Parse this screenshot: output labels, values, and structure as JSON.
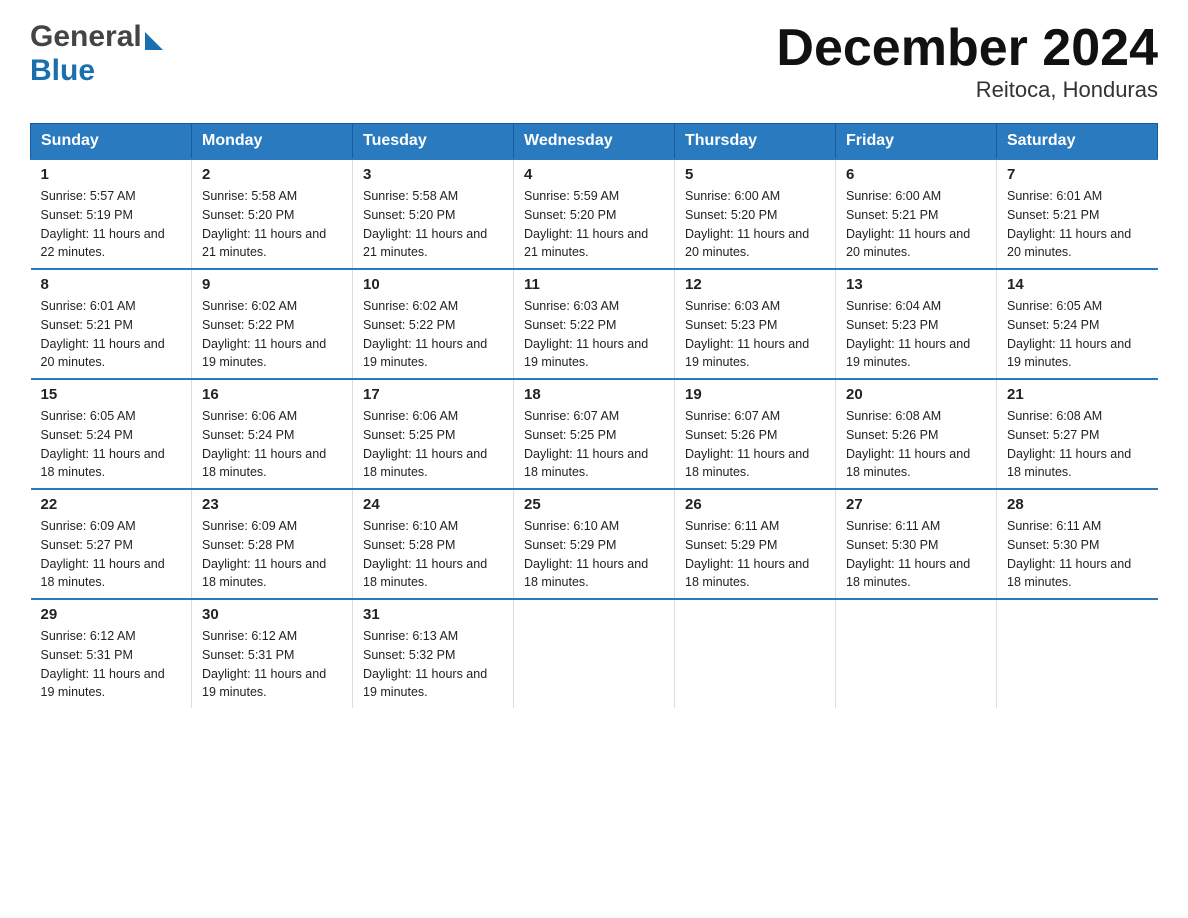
{
  "logo": {
    "general": "General",
    "blue": "Blue",
    "triangle_alt": "arrow"
  },
  "title": "December 2024",
  "subtitle": "Reitoca, Honduras",
  "days_of_week": [
    "Sunday",
    "Monday",
    "Tuesday",
    "Wednesday",
    "Thursday",
    "Friday",
    "Saturday"
  ],
  "weeks": [
    [
      {
        "day": "1",
        "sunrise": "Sunrise: 5:57 AM",
        "sunset": "Sunset: 5:19 PM",
        "daylight": "Daylight: 11 hours and 22 minutes."
      },
      {
        "day": "2",
        "sunrise": "Sunrise: 5:58 AM",
        "sunset": "Sunset: 5:20 PM",
        "daylight": "Daylight: 11 hours and 21 minutes."
      },
      {
        "day": "3",
        "sunrise": "Sunrise: 5:58 AM",
        "sunset": "Sunset: 5:20 PM",
        "daylight": "Daylight: 11 hours and 21 minutes."
      },
      {
        "day": "4",
        "sunrise": "Sunrise: 5:59 AM",
        "sunset": "Sunset: 5:20 PM",
        "daylight": "Daylight: 11 hours and 21 minutes."
      },
      {
        "day": "5",
        "sunrise": "Sunrise: 6:00 AM",
        "sunset": "Sunset: 5:20 PM",
        "daylight": "Daylight: 11 hours and 20 minutes."
      },
      {
        "day": "6",
        "sunrise": "Sunrise: 6:00 AM",
        "sunset": "Sunset: 5:21 PM",
        "daylight": "Daylight: 11 hours and 20 minutes."
      },
      {
        "day": "7",
        "sunrise": "Sunrise: 6:01 AM",
        "sunset": "Sunset: 5:21 PM",
        "daylight": "Daylight: 11 hours and 20 minutes."
      }
    ],
    [
      {
        "day": "8",
        "sunrise": "Sunrise: 6:01 AM",
        "sunset": "Sunset: 5:21 PM",
        "daylight": "Daylight: 11 hours and 20 minutes."
      },
      {
        "day": "9",
        "sunrise": "Sunrise: 6:02 AM",
        "sunset": "Sunset: 5:22 PM",
        "daylight": "Daylight: 11 hours and 19 minutes."
      },
      {
        "day": "10",
        "sunrise": "Sunrise: 6:02 AM",
        "sunset": "Sunset: 5:22 PM",
        "daylight": "Daylight: 11 hours and 19 minutes."
      },
      {
        "day": "11",
        "sunrise": "Sunrise: 6:03 AM",
        "sunset": "Sunset: 5:22 PM",
        "daylight": "Daylight: 11 hours and 19 minutes."
      },
      {
        "day": "12",
        "sunrise": "Sunrise: 6:03 AM",
        "sunset": "Sunset: 5:23 PM",
        "daylight": "Daylight: 11 hours and 19 minutes."
      },
      {
        "day": "13",
        "sunrise": "Sunrise: 6:04 AM",
        "sunset": "Sunset: 5:23 PM",
        "daylight": "Daylight: 11 hours and 19 minutes."
      },
      {
        "day": "14",
        "sunrise": "Sunrise: 6:05 AM",
        "sunset": "Sunset: 5:24 PM",
        "daylight": "Daylight: 11 hours and 19 minutes."
      }
    ],
    [
      {
        "day": "15",
        "sunrise": "Sunrise: 6:05 AM",
        "sunset": "Sunset: 5:24 PM",
        "daylight": "Daylight: 11 hours and 18 minutes."
      },
      {
        "day": "16",
        "sunrise": "Sunrise: 6:06 AM",
        "sunset": "Sunset: 5:24 PM",
        "daylight": "Daylight: 11 hours and 18 minutes."
      },
      {
        "day": "17",
        "sunrise": "Sunrise: 6:06 AM",
        "sunset": "Sunset: 5:25 PM",
        "daylight": "Daylight: 11 hours and 18 minutes."
      },
      {
        "day": "18",
        "sunrise": "Sunrise: 6:07 AM",
        "sunset": "Sunset: 5:25 PM",
        "daylight": "Daylight: 11 hours and 18 minutes."
      },
      {
        "day": "19",
        "sunrise": "Sunrise: 6:07 AM",
        "sunset": "Sunset: 5:26 PM",
        "daylight": "Daylight: 11 hours and 18 minutes."
      },
      {
        "day": "20",
        "sunrise": "Sunrise: 6:08 AM",
        "sunset": "Sunset: 5:26 PM",
        "daylight": "Daylight: 11 hours and 18 minutes."
      },
      {
        "day": "21",
        "sunrise": "Sunrise: 6:08 AM",
        "sunset": "Sunset: 5:27 PM",
        "daylight": "Daylight: 11 hours and 18 minutes."
      }
    ],
    [
      {
        "day": "22",
        "sunrise": "Sunrise: 6:09 AM",
        "sunset": "Sunset: 5:27 PM",
        "daylight": "Daylight: 11 hours and 18 minutes."
      },
      {
        "day": "23",
        "sunrise": "Sunrise: 6:09 AM",
        "sunset": "Sunset: 5:28 PM",
        "daylight": "Daylight: 11 hours and 18 minutes."
      },
      {
        "day": "24",
        "sunrise": "Sunrise: 6:10 AM",
        "sunset": "Sunset: 5:28 PM",
        "daylight": "Daylight: 11 hours and 18 minutes."
      },
      {
        "day": "25",
        "sunrise": "Sunrise: 6:10 AM",
        "sunset": "Sunset: 5:29 PM",
        "daylight": "Daylight: 11 hours and 18 minutes."
      },
      {
        "day": "26",
        "sunrise": "Sunrise: 6:11 AM",
        "sunset": "Sunset: 5:29 PM",
        "daylight": "Daylight: 11 hours and 18 minutes."
      },
      {
        "day": "27",
        "sunrise": "Sunrise: 6:11 AM",
        "sunset": "Sunset: 5:30 PM",
        "daylight": "Daylight: 11 hours and 18 minutes."
      },
      {
        "day": "28",
        "sunrise": "Sunrise: 6:11 AM",
        "sunset": "Sunset: 5:30 PM",
        "daylight": "Daylight: 11 hours and 18 minutes."
      }
    ],
    [
      {
        "day": "29",
        "sunrise": "Sunrise: 6:12 AM",
        "sunset": "Sunset: 5:31 PM",
        "daylight": "Daylight: 11 hours and 19 minutes."
      },
      {
        "day": "30",
        "sunrise": "Sunrise: 6:12 AM",
        "sunset": "Sunset: 5:31 PM",
        "daylight": "Daylight: 11 hours and 19 minutes."
      },
      {
        "day": "31",
        "sunrise": "Sunrise: 6:13 AM",
        "sunset": "Sunset: 5:32 PM",
        "daylight": "Daylight: 11 hours and 19 minutes."
      },
      {
        "day": "",
        "sunrise": "",
        "sunset": "",
        "daylight": ""
      },
      {
        "day": "",
        "sunrise": "",
        "sunset": "",
        "daylight": ""
      },
      {
        "day": "",
        "sunrise": "",
        "sunset": "",
        "daylight": ""
      },
      {
        "day": "",
        "sunrise": "",
        "sunset": "",
        "daylight": ""
      }
    ]
  ]
}
